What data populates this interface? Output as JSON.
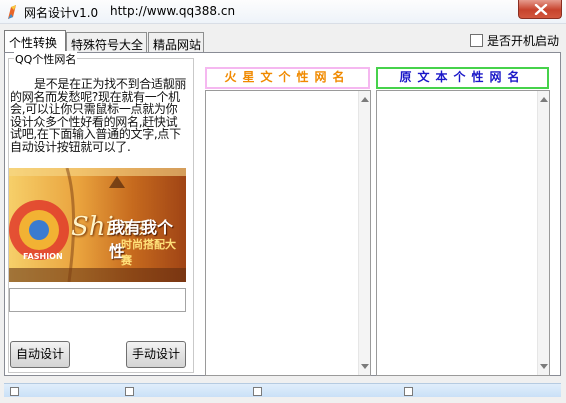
{
  "window": {
    "title": "网名设计v1.0",
    "url": "http://www.qq388.cn",
    "close_icon": "close-icon"
  },
  "tabs": [
    {
      "label": "个性转换",
      "active": true
    },
    {
      "label": "特殊符号大全",
      "active": false
    },
    {
      "label": "精品网站",
      "active": false
    }
  ],
  "autostart": {
    "label": "是否开机启动",
    "checked": false
  },
  "group": {
    "title": "QQ个性网名",
    "description": "是不是在正为找不到合适靓丽的网名而发愁呢?现在就有一个机会,可以让你只需鼠标一点就为你设计众多个性好看的网名,赶快试试吧,在下面输入普通的文字,点下自动设计按钮就可以了."
  },
  "banner": {
    "main_text": "我有我个性",
    "sub_text": "时尚搭配大赛",
    "script_text": "Shine",
    "small_text": "FASHION"
  },
  "input": {
    "value": "",
    "placeholder": ""
  },
  "buttons": {
    "auto": "自动设计",
    "manual": "手动设计"
  },
  "columns": {
    "left": {
      "title": "火星文个性网名",
      "title_color": "#f08a00",
      "border_color": "#f5b8f0"
    },
    "right": {
      "title": "原文本个性网名",
      "title_color": "#1b18c8",
      "border_color": "#46d24b"
    }
  },
  "colors": {
    "titlebar": "#eef3f9",
    "bottombar": "#c9e0f7"
  }
}
